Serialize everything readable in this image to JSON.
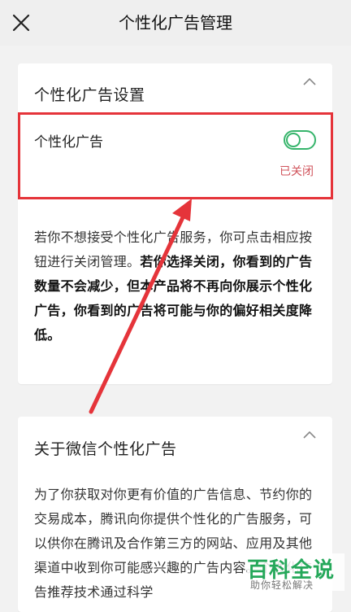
{
  "header": {
    "title": "个性化广告管理",
    "close_icon": "close-icon"
  },
  "settings_card": {
    "title": "个性化广告设置",
    "toggle_label": "个性化广告",
    "toggle_state": "off",
    "status_text": "已关闭",
    "desc_plain": "若你不想接受个性化广告服务，你可点击相应按钮进行关闭管理。",
    "desc_bold": "若你选择关闭，你看到的广告数量不会减少，但本产品将不再向你展示个性化广告，你看到的广告将可能与你的偏好相关度降低。"
  },
  "about_card": {
    "title": "关于微信个性化广告",
    "desc": "为了你获取对你更有价值的广告信息、节约你的交易成本，腾讯向你提供个性化的广告服务，可以供你在腾讯及合作第三方的网站、应用及其他渠道中收到你可能感兴趣的广告内容。个性化广告推荐技术通过科学"
  },
  "watermark": {
    "main": "百科全说",
    "sub": "助你轻松解决"
  },
  "colors": {
    "accent_green": "#36b46b",
    "status_red": "#d0535b",
    "annotation_red": "#e5343a"
  }
}
